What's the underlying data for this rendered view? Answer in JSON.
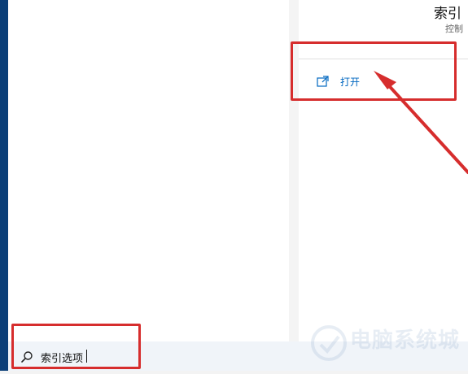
{
  "details": {
    "title": "索引",
    "subtitle": "控制",
    "action_open": {
      "label": "打开",
      "icon": "open-external-icon"
    }
  },
  "search": {
    "value": "索引选项",
    "icon": "search-icon"
  },
  "annotations": {
    "color": "#d62d2d"
  },
  "watermark": {
    "text": "电脑系统城"
  },
  "colors": {
    "accent": "#0067c0",
    "left_strip": "#0b3f78",
    "search_bar_bg": "#f0f4f9"
  }
}
